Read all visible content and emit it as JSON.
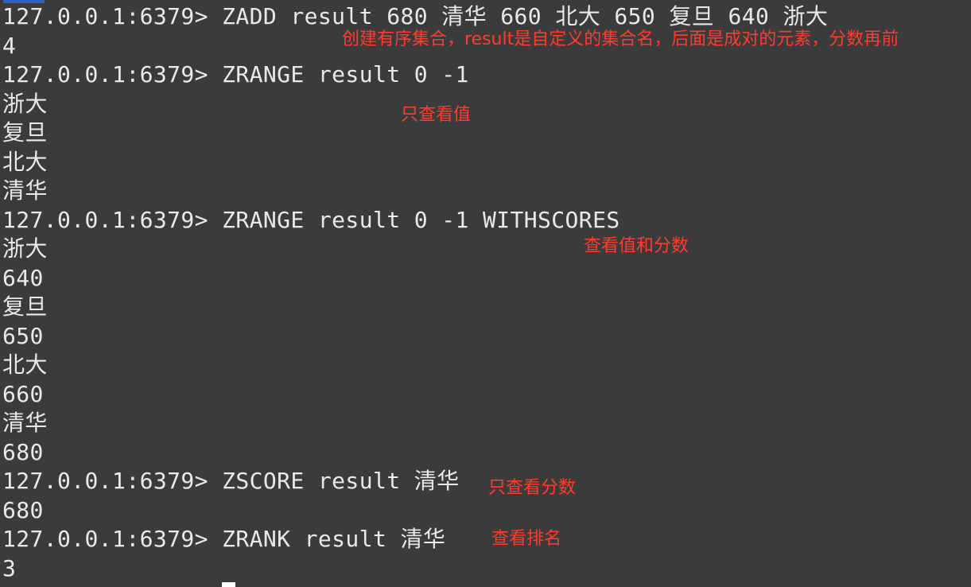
{
  "terminal": {
    "lines": [
      "127.0.0.1:6379> ZADD result 680 清华 660 北大 650 复旦 640 浙大",
      "4",
      "127.0.0.1:6379> ZRANGE result 0 -1",
      "浙大",
      "复旦",
      "北大",
      "清华",
      "127.0.0.1:6379> ZRANGE result 0 -1 WITHSCORES",
      "浙大",
      "640",
      "复旦",
      "650",
      "北大",
      "660",
      "清华",
      "680",
      "127.0.0.1:6379> ZSCORE result 清华",
      "680",
      "127.0.0.1:6379> ZRANK result 清华",
      "3"
    ]
  },
  "annotations": {
    "zadd": "创建有序集合，result是自定义的集合名，后面是成对的元素，分数再前",
    "zrange": "只查看值",
    "zrange_withscores": "查看值和分数",
    "zscore": "只查看分数",
    "zrank": "查看排名"
  },
  "colors": {
    "background": "#3b3b3b",
    "text": "#e9e9e9",
    "annotation": "#ff3b30",
    "cursor": "#ffffff"
  }
}
